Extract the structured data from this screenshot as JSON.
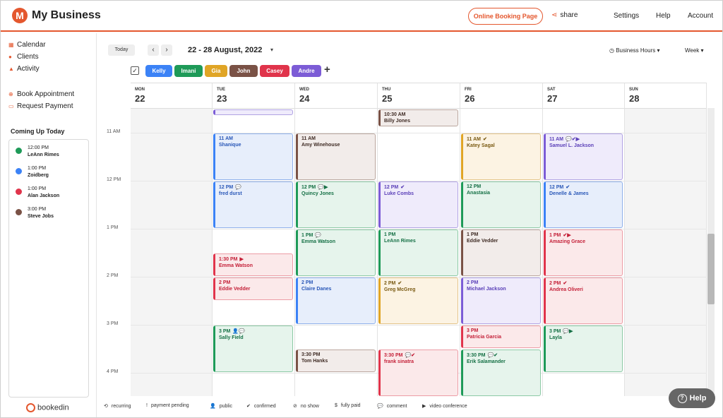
{
  "header": {
    "logo_letter": "M",
    "brand": "My Business",
    "online_booking": "Online Booking Page",
    "share": "share",
    "nav": [
      "Settings",
      "Help",
      "Account"
    ]
  },
  "sidebar": {
    "items": [
      "Calendar",
      "Clients",
      "Activity",
      "Book Appointment",
      "Request Payment"
    ],
    "coming_up_title": "Coming Up Today",
    "coming_up": [
      {
        "time": "12:00 PM",
        "name": "LeAnn Rimes",
        "color": "#1e9a58"
      },
      {
        "time": "1:00 PM",
        "name": "Zoidberg",
        "color": "#3b82f6"
      },
      {
        "time": "1:00 PM",
        "name": "Alan Jackson",
        "color": "#e0344b"
      },
      {
        "time": "3:00 PM",
        "name": "Steve Jobs",
        "color": "#7a5246"
      }
    ],
    "footer_logo": "bookedin"
  },
  "toolbar": {
    "today": "Today",
    "prev": "‹",
    "next": "›",
    "date_range": "22 - 28 August, 2022",
    "business_hours": "Business Hours",
    "view": "Week"
  },
  "staff": [
    {
      "name": "Kelly",
      "color": "#3b82f6"
    },
    {
      "name": "Imani",
      "color": "#1e9a58"
    },
    {
      "name": "Gia",
      "color": "#e0a526"
    },
    {
      "name": "John",
      "color": "#7a5246"
    },
    {
      "name": "Casey",
      "color": "#e0344b"
    },
    {
      "name": "Andre",
      "color": "#7c5cd6"
    }
  ],
  "days": [
    {
      "name": "MON",
      "date": "22"
    },
    {
      "name": "TUE",
      "date": "23"
    },
    {
      "name": "WED",
      "date": "24"
    },
    {
      "name": "THU",
      "date": "25"
    },
    {
      "name": "FRI",
      "date": "26"
    },
    {
      "name": "SAT",
      "date": "27"
    },
    {
      "name": "SUN",
      "date": "28"
    }
  ],
  "times": [
    "11 AM",
    "12 PM",
    "1 PM",
    "2 PM",
    "3 PM",
    "4 PM"
  ],
  "appointments": [
    {
      "day": 1,
      "start": 10.0,
      "end": 10.5,
      "time": "",
      "name": "",
      "color": "purple",
      "icons": ""
    },
    {
      "day": 3,
      "start": 10.0,
      "end": 10.5,
      "time": "10:30 AM",
      "name": "Billy Jones",
      "color": "brown",
      "icons": ""
    },
    {
      "day": 1,
      "start": 11.0,
      "end": 12.0,
      "time": "11 AM",
      "name": "Shanique",
      "color": "blue",
      "icons": ""
    },
    {
      "day": 2,
      "start": 11.0,
      "end": 12.0,
      "time": "11 AM",
      "name": "Amy Winehouse",
      "color": "brown",
      "icons": ""
    },
    {
      "day": 4,
      "start": 11.0,
      "end": 12.0,
      "time": "11 AM",
      "name": "Katey Sagal",
      "color": "gold",
      "icons": "✔"
    },
    {
      "day": 5,
      "start": 11.0,
      "end": 12.0,
      "time": "11 AM",
      "name": "Samuel L. Jackson",
      "color": "purple",
      "icons": "💬✔▶"
    },
    {
      "day": 1,
      "start": 12.0,
      "end": 13.0,
      "time": "12 PM",
      "name": "fred durst",
      "color": "blue",
      "icons": "💬"
    },
    {
      "day": 2,
      "start": 12.0,
      "end": 13.0,
      "time": "12 PM",
      "name": "Quincy Jones",
      "color": "green",
      "icons": "💬▶"
    },
    {
      "day": 3,
      "start": 12.0,
      "end": 13.0,
      "time": "12 PM",
      "name": "Luke Combs",
      "color": "purple",
      "icons": "✔"
    },
    {
      "day": 4,
      "start": 12.0,
      "end": 13.0,
      "time": "12 PM",
      "name": "Anastasia",
      "color": "green",
      "icons": ""
    },
    {
      "day": 5,
      "start": 12.0,
      "end": 13.0,
      "time": "12 PM",
      "name": "Denelle & James",
      "color": "blue",
      "icons": "✔"
    },
    {
      "day": 2,
      "start": 13.0,
      "end": 14.0,
      "time": "1 PM",
      "name": "Emma Watson",
      "color": "green",
      "icons": "💬"
    },
    {
      "day": 3,
      "start": 13.0,
      "end": 14.0,
      "time": "1 PM",
      "name": "LeAnn Rimes",
      "color": "green",
      "icons": ""
    },
    {
      "day": 4,
      "start": 13.0,
      "end": 14.0,
      "time": "1 PM",
      "name": "Eddie Vedder",
      "color": "brown",
      "icons": ""
    },
    {
      "day": 5,
      "start": 13.0,
      "end": 14.0,
      "time": "1 PM",
      "name": "Amazing Grace",
      "color": "red",
      "icons": "✔▶"
    },
    {
      "day": 1,
      "start": 13.5,
      "end": 14.0,
      "time": "1:30 PM",
      "name": "Emma Watson",
      "color": "red",
      "icons": "▶"
    },
    {
      "day": 1,
      "start": 14.0,
      "end": 14.5,
      "time": "2 PM",
      "name": "Eddie Vedder",
      "color": "red",
      "icons": ""
    },
    {
      "day": 2,
      "start": 14.0,
      "end": 15.0,
      "time": "2 PM",
      "name": "Claire Danes",
      "color": "blue",
      "icons": ""
    },
    {
      "day": 3,
      "start": 14.0,
      "end": 15.0,
      "time": "2 PM",
      "name": "Greg McGreg",
      "color": "gold",
      "icons": "✔"
    },
    {
      "day": 4,
      "start": 14.0,
      "end": 15.0,
      "time": "2 PM",
      "name": "Michael Jackson",
      "color": "purple",
      "icons": ""
    },
    {
      "day": 5,
      "start": 14.0,
      "end": 15.0,
      "time": "2 PM",
      "name": "Andrea Oliveri",
      "color": "red",
      "icons": "✔"
    },
    {
      "day": 1,
      "start": 15.0,
      "end": 16.0,
      "time": "3 PM",
      "name": "Sally Field",
      "color": "green",
      "icons": "👤💬"
    },
    {
      "day": 4,
      "start": 15.0,
      "end": 15.5,
      "time": "3 PM",
      "name": "Patricia Garcia",
      "color": "red",
      "icons": ""
    },
    {
      "day": 5,
      "start": 15.0,
      "end": 16.0,
      "time": "3 PM",
      "name": "Layla",
      "color": "green",
      "icons": "💬▶"
    },
    {
      "day": 2,
      "start": 15.5,
      "end": 16.0,
      "time": "3:30 PM",
      "name": "Tom Hanks",
      "color": "brown",
      "icons": ""
    },
    {
      "day": 3,
      "start": 15.5,
      "end": 16.5,
      "time": "3:30 PM",
      "name": "frank sinatra",
      "color": "red",
      "icons": "💬✔"
    },
    {
      "day": 4,
      "start": 15.5,
      "end": 16.5,
      "time": "3:30 PM",
      "name": "Erik Salamander",
      "color": "green",
      "icons": "💬✔"
    }
  ],
  "legend": [
    {
      "icon": "⟲",
      "label": "recurring"
    },
    {
      "icon": "!",
      "label": "payment pending"
    },
    {
      "icon": "👤",
      "label": "public"
    },
    {
      "icon": "✔",
      "label": "confirmed"
    },
    {
      "icon": "⊘",
      "label": "no show"
    },
    {
      "icon": "$",
      "label": "fully paid"
    },
    {
      "icon": "💬",
      "label": "comment"
    },
    {
      "icon": "▶",
      "label": "video conference"
    }
  ],
  "help_button": "Help"
}
